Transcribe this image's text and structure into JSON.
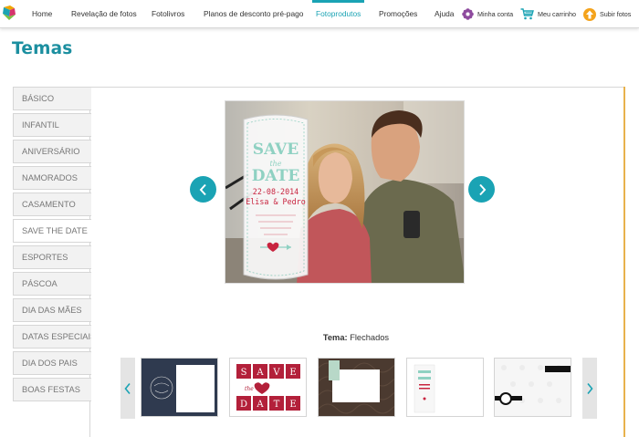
{
  "nav": {
    "items": [
      {
        "label": "Home"
      },
      {
        "label": "Revelação de fotos"
      },
      {
        "label": "Fotolivros"
      },
      {
        "label": "Planos de desconto pré-pago"
      },
      {
        "label": "Fotoprodutos"
      },
      {
        "label": "Promoções"
      },
      {
        "label": "Ajuda"
      }
    ],
    "active": "Fotoprodutos",
    "account_label": "Minha conta",
    "cart_label": "Meu carrinho",
    "upload_label": "Subir fotos"
  },
  "page": {
    "title": "Temas"
  },
  "sidebar": {
    "items": [
      {
        "label": "BÁSICO"
      },
      {
        "label": "INFANTIL"
      },
      {
        "label": "ANIVERSÁRIO"
      },
      {
        "label": "NAMORADOS"
      },
      {
        "label": "CASAMENTO"
      },
      {
        "label": "SAVE THE DATE"
      },
      {
        "label": "ESPORTES"
      },
      {
        "label": "PÁSCOA"
      },
      {
        "label": "DIA DAS MÃES"
      },
      {
        "label": "DATAS ESPECIAIS"
      },
      {
        "label": "DIA DOS PAIS"
      },
      {
        "label": "BOAS FESTAS"
      }
    ],
    "active": "SAVE THE DATE"
  },
  "preview": {
    "card_title_line1": "SAVE",
    "card_title_the": "the",
    "card_title_line2": "DATE",
    "card_date": "22-08-2014",
    "card_names": "Elisa & Pedro"
  },
  "theme": {
    "label": "Tema:",
    "value": "Flechados"
  },
  "thumbnails": {
    "t2_letters": [
      "S",
      "A",
      "V",
      "E",
      "D",
      "A",
      "T",
      "E"
    ],
    "t2_the": "the"
  },
  "colors": {
    "accent": "#1aa3b4",
    "title": "#1c8fa0",
    "panel_edge": "#e8b24c",
    "card_red": "#c8243f",
    "card_mint": "#8fd1c2"
  },
  "icons": {
    "logo": "logo-icon",
    "account": "flower-icon",
    "cart": "cart-icon",
    "upload": "upload-arrow-icon"
  }
}
